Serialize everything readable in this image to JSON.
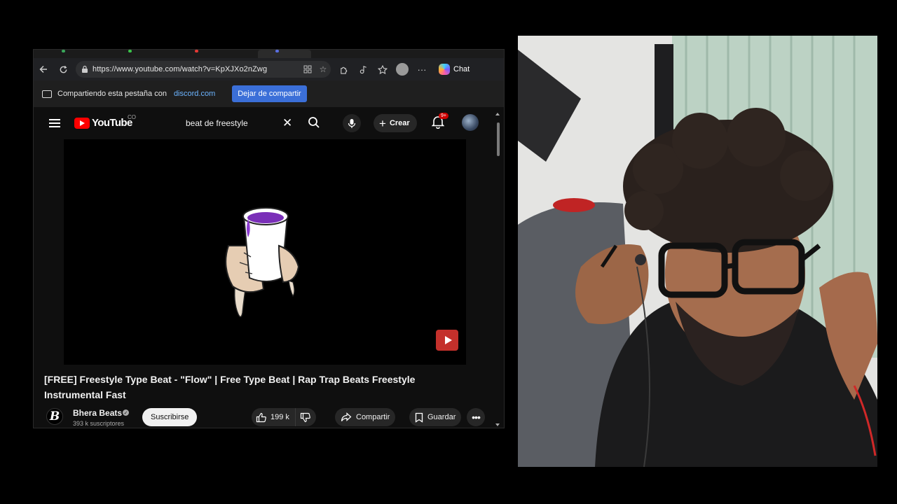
{
  "browser": {
    "url": "https://www.youtube.com/watch?v=KpXJXo2nZwg",
    "chat_label": "Chat",
    "share_bar": {
      "message": "Compartiendo esta pestaña con",
      "domain": "discord.com",
      "stop_label": "Dejar de compartir"
    }
  },
  "youtube": {
    "logo_text": "YouTube",
    "country_code": "CO",
    "search_query": "beat de freestyle",
    "create_label": "Crear",
    "notification_badge": "9+",
    "video": {
      "title": "[FREE] Freestyle Type Beat - \"Flow\" | Free Type Beat | Rap Trap Beats Freestyle Instrumental Fast",
      "channel_name": "Bhera Beats",
      "channel_initial": "B",
      "subscribers": "393 k suscriptores",
      "subscribe_label": "Suscribirse",
      "likes": "199 k",
      "share_label": "Compartir",
      "save_label": "Guardar"
    }
  },
  "colors": {
    "youtube_red": "#ff0000",
    "share_button": "#3b6fd8",
    "page_background": "#0f0f0f"
  }
}
